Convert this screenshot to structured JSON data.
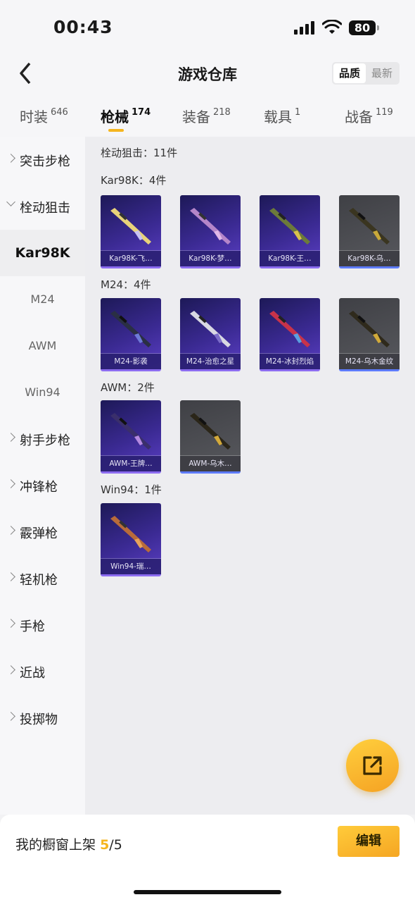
{
  "status": {
    "time": "00:43",
    "battery": "80"
  },
  "nav": {
    "title": "游戏仓库",
    "sort_options": [
      "品质",
      "最新"
    ],
    "sort_active": "品质"
  },
  "tabs": [
    {
      "label": "时装",
      "count": "646"
    },
    {
      "label": "枪械",
      "count": "174"
    },
    {
      "label": "装备",
      "count": "218"
    },
    {
      "label": "载具",
      "count": "1"
    },
    {
      "label": "战备",
      "count": "119"
    }
  ],
  "sidebar": {
    "items": [
      {
        "label": "突击步枪"
      },
      {
        "label": "栓动狙击"
      },
      {
        "label": "Kar98K"
      },
      {
        "label": "M24"
      },
      {
        "label": "AWM"
      },
      {
        "label": "Win94"
      },
      {
        "label": "射手步枪"
      },
      {
        "label": "冲锋枪"
      },
      {
        "label": "霰弹枪"
      },
      {
        "label": "轻机枪"
      },
      {
        "label": "手枪"
      },
      {
        "label": "近战"
      },
      {
        "label": "投掷物"
      }
    ]
  },
  "content": {
    "summary": "栓动狙击：11件",
    "sections": [
      {
        "heading": "Kar98K：4件",
        "items": [
          "Kar98K-飞…",
          "Kar98K-梦…",
          "Kar98K-王…",
          "Kar98K-乌…"
        ]
      },
      {
        "heading": "M24：4件",
        "items": [
          "M24-影袭",
          "M24-治愈之星",
          "M24-冰封烈焰",
          "M24-乌木金纹"
        ]
      },
      {
        "heading": "AWM：2件",
        "items": [
          "AWM-王牌…",
          "AWM-乌木…"
        ]
      },
      {
        "heading": "Win94：1件",
        "items": [
          "Win94-瑞…"
        ]
      }
    ]
  },
  "bottom": {
    "shelf_label": "我的橱窗上架",
    "shelf_current": "5",
    "shelf_total": "/5",
    "edit_label": "编辑"
  },
  "colors": {
    "accent": "#f5b51f",
    "card_purple": "#3b2a93",
    "card_gray": "#55565b"
  }
}
